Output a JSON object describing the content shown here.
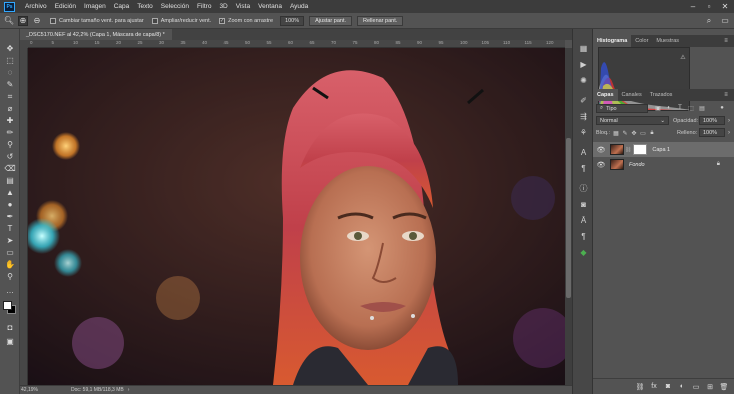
{
  "menu": [
    "Archivo",
    "Edición",
    "Imagen",
    "Capa",
    "Texto",
    "Selección",
    "Filtro",
    "3D",
    "Vista",
    "Ventana",
    "Ayuda"
  ],
  "options": {
    "resize_windows": "Cambiar tamaño vent. para ajustar",
    "zoom_all": "Ampliar/reducir vent.",
    "scrubby_zoom": "Zoom con arrastre",
    "zoom_value": "100%",
    "fit_screen": "Ajustar pant.",
    "fill_screen": "Rellenar pant."
  },
  "document": {
    "tab_title": "_DSC5170.NEF al 42,2% (Capa 1, Máscara de capa/8) *",
    "zoom": "42,19%",
    "doc_info": "Doc: 59,1 MB/118,3 MB"
  },
  "ruler_numbers": [
    "0",
    "5",
    "10",
    "15",
    "20",
    "25",
    "30",
    "35",
    "40",
    "45",
    "50",
    "55",
    "60",
    "65",
    "70",
    "75",
    "80",
    "85",
    "90",
    "95",
    "100",
    "105",
    "110",
    "115",
    "120"
  ],
  "panels": {
    "histogram_tabs": [
      "Histograma",
      "Color",
      "Muestras"
    ],
    "layers_tabs": [
      "Capas",
      "Canales",
      "Trazados"
    ],
    "filter_kind": "Tipo",
    "blend_mode": "Normal",
    "opacity_label": "Opacidad:",
    "opacity_value": "100%",
    "lock_label": "Bloq.:",
    "fill_label": "Relleno:",
    "fill_value": "100%"
  },
  "layers": [
    {
      "name": "Capa 1",
      "selected": true
    },
    {
      "name": "Fondo",
      "selected": false
    }
  ],
  "icons": {
    "accent": "#31a8ff"
  }
}
